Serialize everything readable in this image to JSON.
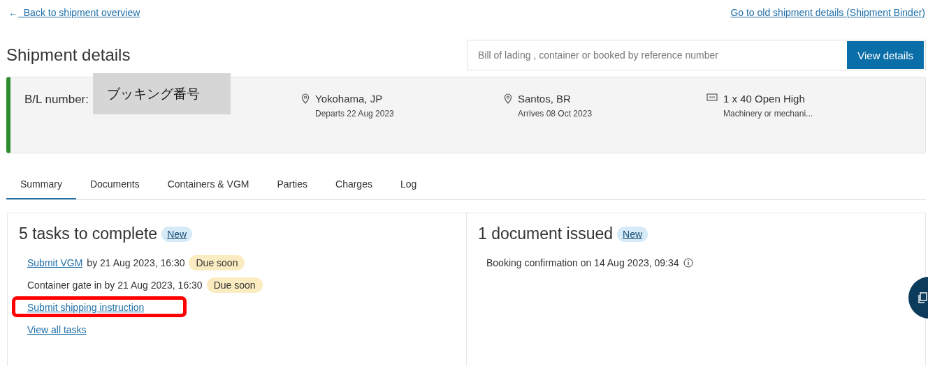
{
  "top_links": {
    "back": {
      "arrow": "←",
      "label": "Back to shipment overview"
    },
    "old": "Go to old shipment details (Shipment Binder)"
  },
  "title": "Shipment details",
  "search": {
    "placeholder": "Bill of lading , container or booked by reference number",
    "button": "View details"
  },
  "shipment": {
    "bl_label": "B/L number:",
    "annotation": "ブッキング番号",
    "legs": [
      {
        "kind": "location",
        "main": "Yokohama, JP",
        "sub": "Departs 22 Aug 2023"
      },
      {
        "kind": "location",
        "main": "Santos, BR",
        "sub": "Arrives 08 Oct 2023"
      },
      {
        "kind": "container",
        "main": "1 x 40 Open High",
        "sub": "Machinery or mechani..."
      }
    ]
  },
  "tabs": [
    {
      "label": "Summary",
      "selected": true
    },
    {
      "label": "Documents",
      "selected": false
    },
    {
      "label": "Containers & VGM",
      "selected": false
    },
    {
      "label": "Parties",
      "selected": false
    },
    {
      "label": "Charges",
      "selected": false
    },
    {
      "label": "Log",
      "selected": false
    }
  ],
  "tasks": {
    "title": "5 tasks to complete",
    "badge": "New",
    "items": [
      {
        "link": "Submit VGM",
        "text": "by 21 Aug 2023, 16:30",
        "badge": "Due soon",
        "highlighted": false
      },
      {
        "text": "Container gate in by 21 Aug 2023, 16:30",
        "badge": "Due soon",
        "highlighted": false
      },
      {
        "link": "Submit shipping instruction",
        "highlighted": true
      }
    ],
    "more": "View all tasks"
  },
  "documents": {
    "title": "1 document issued",
    "badge": "New",
    "items": [
      {
        "text": "Booking confirmation on 14 Aug 2023, 09:34"
      }
    ]
  }
}
